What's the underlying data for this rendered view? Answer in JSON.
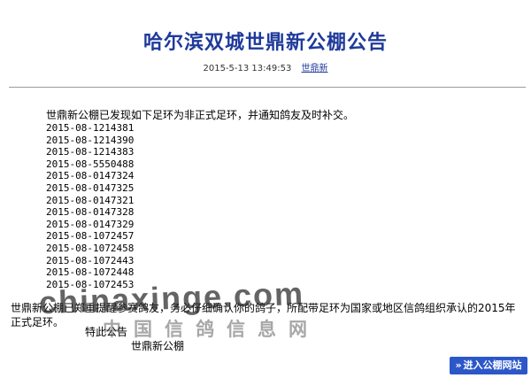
{
  "header": {
    "title": "哈尔滨双城世鼎新公棚公告",
    "timestamp": "2015-5-13 13:49:53",
    "author": "世鼎新"
  },
  "content": {
    "intro": "世鼎新公棚已发现如下足环为非正式足环，并通知鸽友及时补交。",
    "rings": [
      "2015-08-1214381",
      "2015-08-1214390",
      "2015-08-1214383",
      "2015-08-5550488",
      "2015-08-0147324",
      "2015-08-0147325",
      "2015-08-0147321",
      "2015-08-0147328",
      "2015-08-0147329",
      "2015-08-1072457",
      "2015-08-1072458",
      "2015-08-1072443",
      "2015-08-1072448",
      "2015-08-1072453"
    ],
    "body": "世鼎新公棚已郑重提醒参赛鸽友，务必仔细确认你的鸽子，所配带足环为国家或地区信鸽组织承认的2015年正式足环。",
    "closing": "特此公告",
    "signature": "世鼎新公棚"
  },
  "watermark": {
    "text": "chinaxinge.com",
    "cn": "中国信鸽信息网"
  },
  "buttons": {
    "enter": "进入公棚网站",
    "enter_arrow": "»"
  },
  "colors": {
    "title": "#1f3a9a",
    "button_bg": "#2c57c9",
    "divider": "#9a9a9a"
  }
}
